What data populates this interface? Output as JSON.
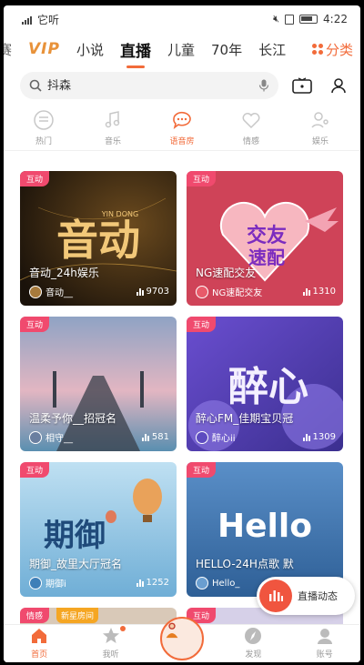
{
  "status_bar": {
    "carrier": "它听",
    "time": "4:22"
  },
  "tabs": [
    {
      "label": "赛",
      "kind": "partial"
    },
    {
      "label": "VIP",
      "kind": "vip"
    },
    {
      "label": "小说",
      "kind": "normal"
    },
    {
      "label": "直播",
      "kind": "active"
    },
    {
      "label": "儿童",
      "kind": "normal"
    },
    {
      "label": "70年",
      "kind": "normal"
    },
    {
      "label": "长江",
      "kind": "normal"
    }
  ],
  "category_button": "分类",
  "search": {
    "placeholder": "抖森"
  },
  "subcats": [
    {
      "label": "热门",
      "icon": "hot-icon",
      "active": false
    },
    {
      "label": "音乐",
      "icon": "music-note-icon",
      "active": false
    },
    {
      "label": "语音房",
      "icon": "chat-bubble-icon",
      "active": true
    },
    {
      "label": "情感",
      "icon": "heart-icon",
      "active": false
    },
    {
      "label": "娱乐",
      "icon": "person-mic-icon",
      "active": false
    }
  ],
  "cards": [
    {
      "badge": "互动",
      "title": "音动_24h娱乐",
      "host": "音动__",
      "count": "9703",
      "art_text": "音动",
      "art_sub": "YIN DONG"
    },
    {
      "badge": "互动",
      "title": "NG速配交友",
      "host": "NG速配交友",
      "count": "1310",
      "art_text": "交友",
      "art_sub": "速配"
    },
    {
      "badge": "互动",
      "title": "温柔予你__招冠名",
      "host": "相守__",
      "count": "581",
      "art_text": "",
      "art_sub": ""
    },
    {
      "badge": "互动",
      "title": "醉心FM_佳期宝贝冠",
      "host": "醉心ii",
      "count": "1309",
      "art_text": "醉心",
      "art_sub": ""
    },
    {
      "badge": "互动",
      "title": "期御_故里大厅冠名",
      "host": "期御i",
      "count": "1252",
      "art_text": "期御",
      "art_sub": ""
    },
    {
      "badge": "互动",
      "title": "HELLO-24H点歌 默",
      "host": "Hello_",
      "count": "",
      "art_text": "Hello",
      "art_sub": ""
    }
  ],
  "peek": {
    "left_badge": "情感",
    "left_badge2": "新星房间",
    "right_badge": "互动"
  },
  "live_float": "直播动态",
  "bottom_nav": [
    {
      "label": "首页",
      "active": true
    },
    {
      "label": "我听",
      "active": false
    },
    {
      "label": "",
      "active": false
    },
    {
      "label": "发现",
      "active": false
    },
    {
      "label": "账号",
      "active": false
    }
  ],
  "colors": {
    "accent": "#f26b3a",
    "badge": "#f04a6e"
  }
}
